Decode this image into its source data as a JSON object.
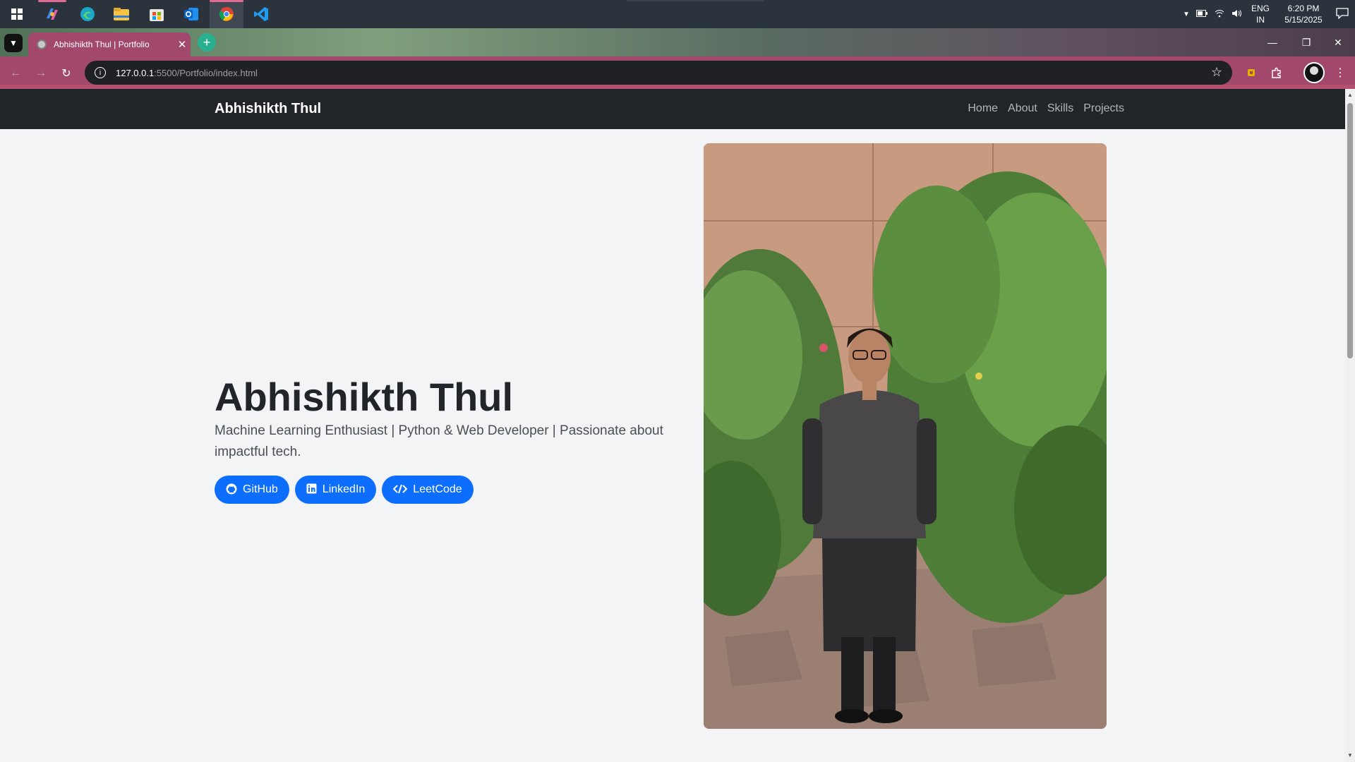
{
  "taskbar": {
    "apps": [
      "windows-start",
      "copilot",
      "edge",
      "file-explorer",
      "microsoft-store",
      "outlook",
      "chrome",
      "vscode"
    ],
    "tray": {
      "lang_top": "ENG",
      "lang_bottom": "IN",
      "time": "6:20 PM",
      "date": "5/15/2025"
    }
  },
  "browser": {
    "tab_title": "Abhishikth Thul | Portfolio",
    "url_host": "127.0.0.1",
    "url_rest": ":5500/Portfolio/index.html"
  },
  "page": {
    "brand": "Abhishikth Thul",
    "nav": [
      "Home",
      "About",
      "Skills",
      "Projects"
    ],
    "hero_name": "Abhishikth Thul",
    "hero_tagline": "Machine Learning Enthusiast | Python & Web Developer | Passionate about impactful tech.",
    "buttons": [
      {
        "label": "GitHub",
        "icon": "github-icon"
      },
      {
        "label": "LinkedIn",
        "icon": "linkedin-icon"
      },
      {
        "label": "LeetCode",
        "icon": "code-icon"
      }
    ],
    "accent": "#0d6efd",
    "navbar_color": "#212529"
  }
}
